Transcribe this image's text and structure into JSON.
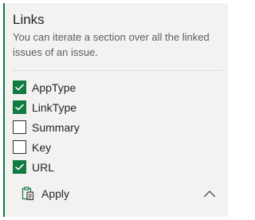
{
  "panel": {
    "title": "Links",
    "description": "You can iterate a section over all the linked issues of an issue."
  },
  "options": [
    {
      "label": "AppType",
      "checked": true
    },
    {
      "label": "LinkType",
      "checked": true
    },
    {
      "label": "Summary",
      "checked": false
    },
    {
      "label": "Key",
      "checked": false
    },
    {
      "label": "URL",
      "checked": true
    }
  ],
  "footer": {
    "apply_label": "Apply",
    "apply_icon": "clipboard-icon",
    "collapse_icon": "chevron-up-icon"
  },
  "colors": {
    "accent": "#107c41",
    "panel_background": "#f3f2f1",
    "text": "#252423",
    "muted_text": "#605e5c"
  }
}
